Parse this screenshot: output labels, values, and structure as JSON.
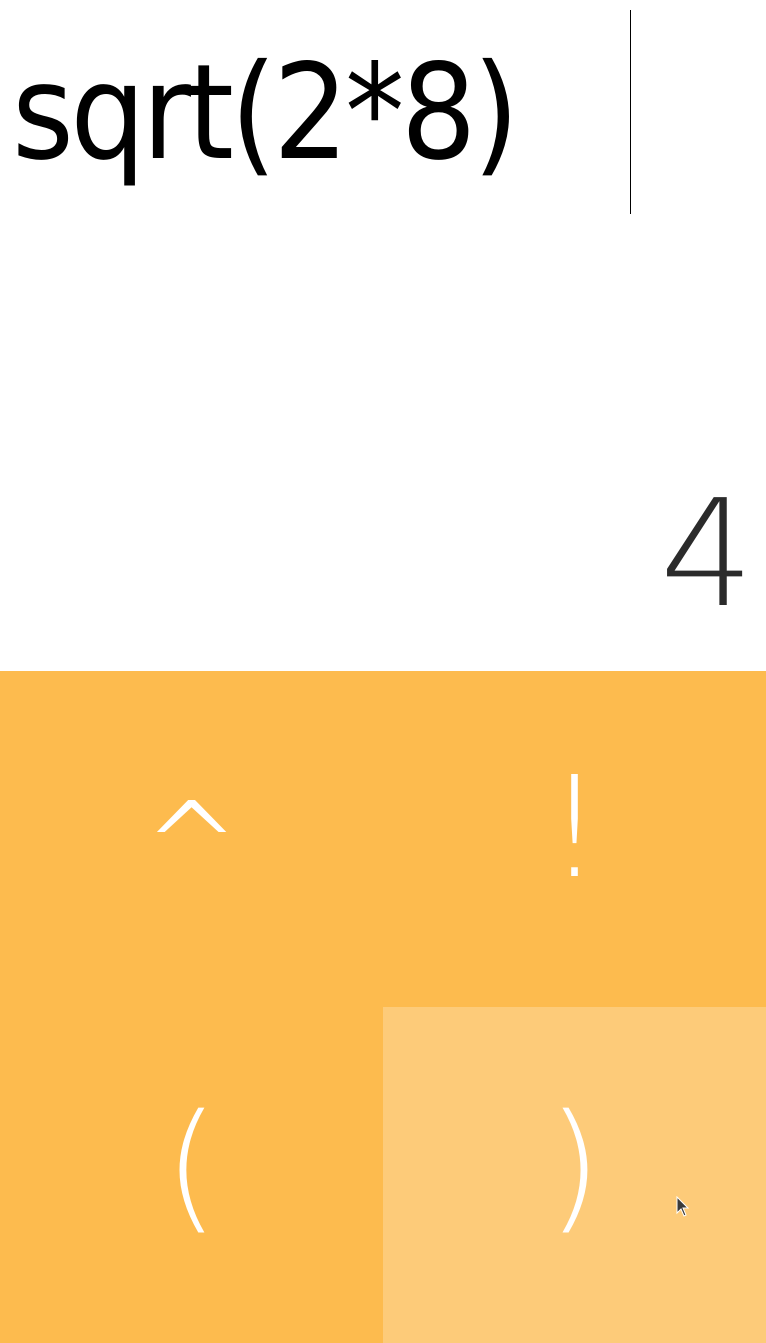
{
  "display": {
    "expression": "sqrt(2*8)",
    "result": "4"
  },
  "keypad": {
    "keys": [
      {
        "label": "^"
      },
      {
        "label": "!"
      },
      {
        "label": "("
      },
      {
        "label": ")"
      }
    ]
  },
  "colors": {
    "key_background": "#fdbb4e",
    "key_hover_background": "#fdcb79",
    "key_text": "#ffffff",
    "display_background": "#ffffff",
    "expression_text": "#000000",
    "result_text": "#2b2b2b"
  },
  "icons": {
    "mouse_pointer": "cursor-arrow-icon"
  }
}
